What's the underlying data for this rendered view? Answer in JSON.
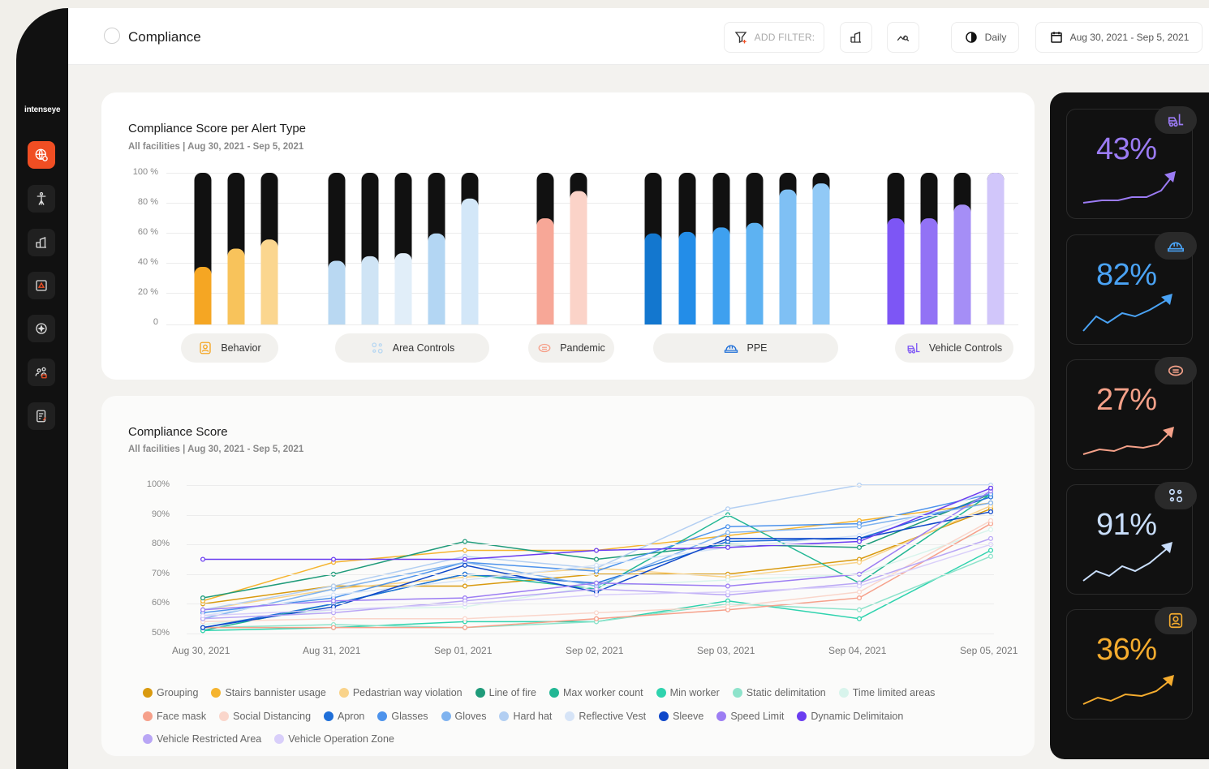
{
  "app": {
    "brand": "intenseye"
  },
  "header": {
    "title": "Compliance",
    "add_filter_label": "ADD FILTER:",
    "granularity_label": "Daily",
    "date_range_label": "Aug 30, 2021 - Sep 5, 2021"
  },
  "sidebar": {
    "items": [
      {
        "name": "global-icon",
        "active": true
      },
      {
        "name": "worker-icon",
        "active": false
      },
      {
        "name": "facility-icon",
        "active": false
      },
      {
        "name": "alert-icon",
        "active": false
      },
      {
        "name": "target-icon",
        "active": false
      },
      {
        "name": "users-icon",
        "active": false
      },
      {
        "name": "report-icon",
        "active": false
      }
    ]
  },
  "bar_card": {
    "title": "Compliance Score per Alert Type",
    "subtitle": "All facilities | Aug 30, 2021 - Sep 5, 2021",
    "yticks": [
      "100 %",
      "80 %",
      "60 %",
      "40 %",
      "20 %",
      "0"
    ],
    "groups": [
      {
        "label": "Behavior",
        "icon": "behavior-icon"
      },
      {
        "label": "Area Controls",
        "icon": "area-controls-icon"
      },
      {
        "label": "Pandemic",
        "icon": "pandemic-icon"
      },
      {
        "label": "PPE",
        "icon": "hard-hat-icon"
      },
      {
        "label": "Vehicle Controls",
        "icon": "forklift-icon"
      }
    ]
  },
  "line_card": {
    "title": "Compliance Score",
    "subtitle": "All facilities | Aug 30, 2021 - Sep 5, 2021",
    "yticks": [
      "100%",
      "90%",
      "80%",
      "70%",
      "60%",
      "50%"
    ],
    "xticks": [
      "Aug 30, 2021",
      "Aug 31, 2021",
      "Sep 01, 2021",
      "Sep 02, 2021",
      "Sep 03, 2021",
      "Sep 04, 2021",
      "Sep 05, 2021"
    ],
    "legend_rows": [
      [
        {
          "label": "Grouping",
          "color": "#d99a0f"
        },
        {
          "label": "Stairs bannister usage",
          "color": "#f5b42f"
        },
        {
          "label": "Pedastrian way violation",
          "color": "#f9d38a"
        },
        {
          "label": "Line of fire",
          "color": "#1f9b7a"
        },
        {
          "label": "Max worker count",
          "color": "#22b794"
        },
        {
          "label": "Min worker",
          "color": "#2fd3ae"
        },
        {
          "label": "Static delimitation",
          "color": "#8ee3cb"
        },
        {
          "label": "Time limited areas",
          "color": "#d8f4ec"
        }
      ],
      [
        {
          "label": "Face mask",
          "color": "#f6a08a"
        },
        {
          "label": "Social Distancing",
          "color": "#fad6cb"
        },
        {
          "label": "Apron",
          "color": "#1f6fd8"
        },
        {
          "label": "Glasses",
          "color": "#4d93ec"
        },
        {
          "label": "Gloves",
          "color": "#7fb3ef"
        },
        {
          "label": "Hard hat",
          "color": "#b3cff2"
        },
        {
          "label": "Reflective Vest",
          "color": "#d6e4f7"
        },
        {
          "label": "Sleeve",
          "color": "#0e47c9"
        },
        {
          "label": "Speed Limit",
          "color": "#9c7df3"
        },
        {
          "label": "Dynamic Delimitaion",
          "color": "#6a3cf0"
        }
      ],
      [
        {
          "label": "Vehicle Restricted Area",
          "color": "#b9a6f5"
        },
        {
          "label": "Vehicle Operation Zone",
          "color": "#d9cffa"
        }
      ]
    ]
  },
  "kpis": [
    {
      "value": "43%",
      "color": "#9b7bf4",
      "icon": "forklift-icon"
    },
    {
      "value": "82%",
      "color": "#4aa3f5",
      "icon": "hard-hat-icon"
    },
    {
      "value": "27%",
      "color": "#f5a189",
      "icon": "pandemic-icon"
    },
    {
      "value": "91%",
      "color": "#c9defb",
      "icon": "area-controls-icon"
    },
    {
      "value": "36%",
      "color": "#f5ac2e",
      "icon": "behavior-icon"
    }
  ],
  "chart_data": [
    {
      "type": "bar",
      "title": "Compliance Score per Alert Type",
      "ylim": [
        0,
        100
      ],
      "stacked": true,
      "categories": [
        "Behavior 1",
        "Behavior 2",
        "Behavior 3",
        "Area Controls 1",
        "Area Controls 2",
        "Area Controls 3",
        "Area Controls 4",
        "Area Controls 5",
        "Pandemic 1",
        "Pandemic 2",
        "PPE 1",
        "PPE 2",
        "PPE 3",
        "PPE 4",
        "PPE 5",
        "PPE 6",
        "Vehicle Controls 1",
        "Vehicle Controls 2",
        "Vehicle Controls 3",
        "Vehicle Controls 4"
      ],
      "values": [
        38,
        50,
        56,
        42,
        45,
        47,
        60,
        83,
        70,
        88,
        60,
        61,
        64,
        67,
        89,
        93,
        70,
        70,
        79,
        100
      ],
      "colors": [
        "#f5a623",
        "#f8c35b",
        "#fbd68f",
        "#b9d8f2",
        "#cfe4f5",
        "#e1eef9",
        "#b3d6f3",
        "#d3e7f8",
        "#f7a797",
        "#fbd3c8",
        "#1377cf",
        "#238de8",
        "#3ea0ef",
        "#5db2f2",
        "#7fc0f4",
        "#91c9f6",
        "#7d56f5",
        "#9272f5",
        "#a58ef6",
        "#d1c6fa"
      ]
    },
    {
      "type": "line",
      "title": "Compliance Score",
      "ylim": [
        50,
        100
      ],
      "x": [
        "Aug 30, 2021",
        "Aug 31, 2021",
        "Sep 01, 2021",
        "Sep 02, 2021",
        "Sep 03, 2021",
        "Sep 04, 2021",
        "Sep 05, 2021"
      ],
      "series": [
        {
          "name": "Grouping",
          "color": "#d99a0f",
          "values": [
            60,
            66,
            66,
            70,
            70,
            75,
            92
          ]
        },
        {
          "name": "Stairs bannister usage",
          "color": "#f5b42f",
          "values": [
            61,
            74,
            78,
            78,
            83,
            88,
            94
          ]
        },
        {
          "name": "Pedastrian way violation",
          "color": "#f9d38a",
          "values": [
            58,
            65,
            69,
            72,
            69,
            74,
            93
          ]
        },
        {
          "name": "Line of fire",
          "color": "#1f9b7a",
          "values": [
            62,
            70,
            81,
            75,
            80,
            79,
            97
          ]
        },
        {
          "name": "Max worker count",
          "color": "#22b794",
          "values": [
            51,
            60,
            70,
            65,
            90,
            67,
            97
          ]
        },
        {
          "name": "Min worker",
          "color": "#2fd3ae",
          "values": [
            51,
            52,
            54,
            54,
            61,
            55,
            78
          ]
        },
        {
          "name": "Static delimitation",
          "color": "#8ee3cb",
          "values": [
            52,
            53,
            52,
            54,
            60,
            58,
            76
          ]
        },
        {
          "name": "Time limited areas",
          "color": "#d8f4ec",
          "values": [
            53,
            58,
            59,
            66,
            68,
            70,
            85
          ]
        },
        {
          "name": "Face mask",
          "color": "#f6a08a",
          "values": [
            52,
            52,
            52,
            55,
            58,
            62,
            87
          ]
        },
        {
          "name": "Social Distancing",
          "color": "#fad6cb",
          "values": [
            54,
            55,
            55,
            57,
            59,
            64,
            88
          ]
        },
        {
          "name": "Apron",
          "color": "#1f6fd8",
          "values": [
            52,
            60,
            70,
            67,
            81,
            82,
            96
          ]
        },
        {
          "name": "Glasses",
          "color": "#4d93ec",
          "values": [
            57,
            62,
            74,
            71,
            86,
            87,
            97
          ]
        },
        {
          "name": "Gloves",
          "color": "#7fb3ef",
          "values": [
            55,
            65,
            74,
            66,
            84,
            86,
            94
          ]
        },
        {
          "name": "Hard hat",
          "color": "#b3cff2",
          "values": [
            58,
            66,
            76,
            72,
            92,
            100,
            100
          ]
        },
        {
          "name": "Reflective Vest",
          "color": "#d6e4f7",
          "values": [
            56,
            63,
            68,
            73,
            79,
            83,
            98
          ]
        },
        {
          "name": "Sleeve",
          "color": "#0e47c9",
          "values": [
            52,
            59,
            73,
            64,
            82,
            82,
            91
          ]
        },
        {
          "name": "Speed Limit",
          "color": "#9c7df3",
          "values": [
            58,
            61,
            62,
            67,
            66,
            70,
            98
          ]
        },
        {
          "name": "Dynamic Delimitaion",
          "color": "#6a3cf0",
          "values": [
            75,
            75,
            75,
            78,
            79,
            81,
            99
          ]
        },
        {
          "name": "Vehicle Restricted Area",
          "color": "#b9a6f5",
          "values": [
            55,
            57,
            61,
            65,
            63,
            67,
            82
          ]
        },
        {
          "name": "Vehicle Operation Zone",
          "color": "#d9cffa",
          "values": [
            56,
            58,
            60,
            63,
            64,
            66,
            80
          ]
        }
      ]
    }
  ]
}
